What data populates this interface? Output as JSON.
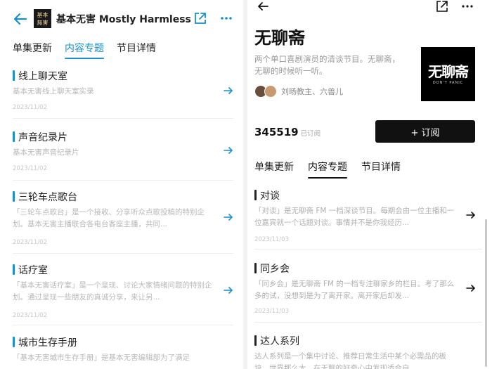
{
  "left": {
    "header": {
      "logo_text": "基本無害",
      "title": "基本无害 Mostly Harmless"
    },
    "tabs": [
      {
        "label": "单集更新",
        "active": false
      },
      {
        "label": "内容专题",
        "active": true
      },
      {
        "label": "节目详情",
        "active": false
      }
    ],
    "items": [
      {
        "title": "线上聊天室",
        "desc": "基本无害线上聊天室实录",
        "date": "2023/11/02"
      },
      {
        "title": "声音纪录片",
        "desc": "基本无害声音纪录片",
        "date": "2023/11/02"
      },
      {
        "title": "三轮车点歌台",
        "desc": "「三轮车点歌台」是一个接收、分享听众点歌投稿的特别企划。基本无害主播联合各电台客座主播，共同...",
        "date": "2023/11/02"
      },
      {
        "title": "话疗室",
        "desc": "「基本无害话疗室」是一个呈现、讨论大家情绪问题的特别企划。通过呈现一些朋友的真诚分享，来让另...",
        "date": "2023/11/02"
      },
      {
        "title": "城市生存手册",
        "desc": "「基本无害城市生存手册」是基本无害编辑部为了满足",
        "date": ""
      }
    ]
  },
  "right": {
    "title": "无聊斋",
    "description": "两个单口喜剧演员的清谈节目。无聊斋，无聊的时候听一听。",
    "cover": {
      "title": "无聊斋",
      "subtitle": "DON'T PANIC"
    },
    "hosts": "刘旸教主、六兽儿",
    "subscribers": "345519",
    "subscribers_label": "已订阅",
    "subscribe_button": "+ 订阅",
    "tabs": [
      {
        "label": "单集更新",
        "active": false
      },
      {
        "label": "内容专题",
        "active": true
      },
      {
        "label": "节目详情",
        "active": false
      }
    ],
    "items": [
      {
        "title": "对谈",
        "desc": "「对谈」是无聊斋 FM 一档深谈节目。每期会由一位主播和一位嘉宾就一个话题对谈。事情并不是你我经历...",
        "date": "2023/11/03"
      },
      {
        "title": "同乡会",
        "desc": "「同乡会」是无聊斋 FM 的一档专注聊家乡的栏目。考了那么多的试，没想到是为了离开家。离开家后却发...",
        "date": "2023/11/03"
      },
      {
        "title": "达人系列",
        "desc": "达人系列是一个集中讨论、推荐日常生活中某个必需品的板块。世界那么大，在无聊的好奇心中发现适合自",
        "date": ""
      }
    ]
  },
  "colors": {
    "accent": "#1a8fc9",
    "subscribe_bg": "#111111"
  }
}
